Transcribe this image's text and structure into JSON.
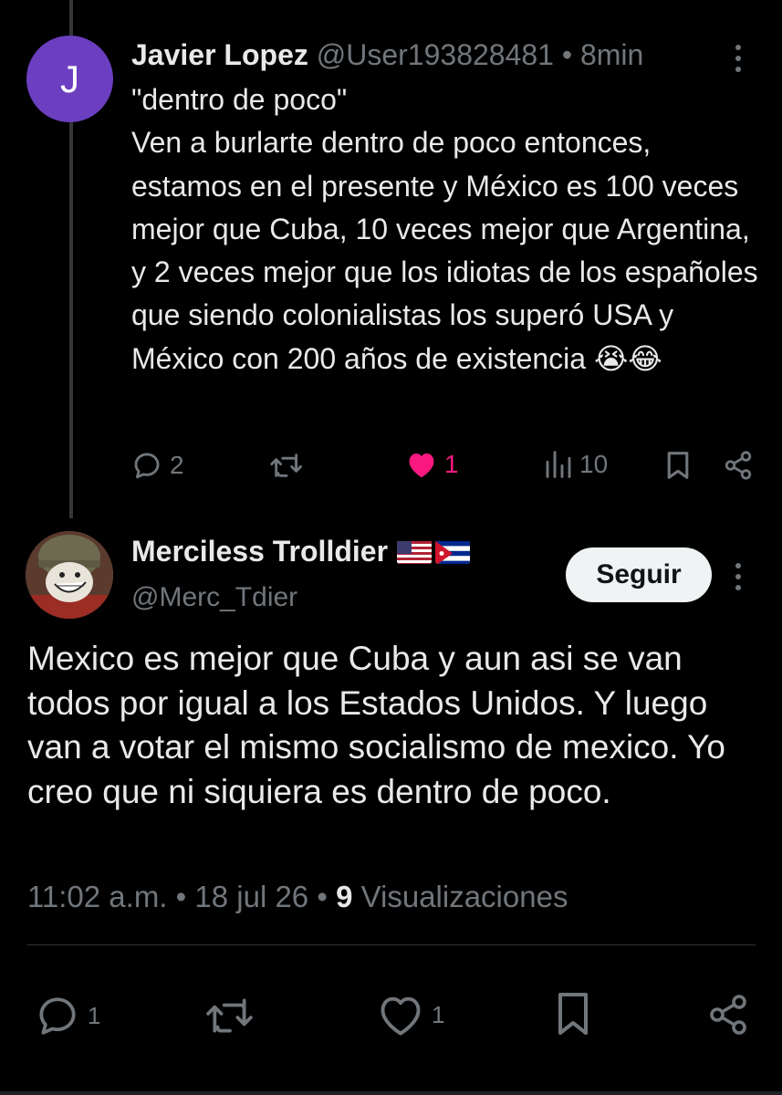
{
  "tweet1": {
    "avatar_letter": "J",
    "name": "Javier Lopez",
    "handle": "@User193828481",
    "separator": "•",
    "time": "8min",
    "text": "\"dentro de poco\"\nVen a burlarte dentro de poco entonces, estamos en el presente y México es 100 veces mejor que Cuba, 10 veces mejor que Argentina, y 2 veces mejor que los idiotas de los españoles que siendo colonialistas los superó USA y México con 200 años de existencia 😭😂",
    "replies": "2",
    "likes": "1",
    "views": "10",
    "liked": true,
    "like_color": "#f91880"
  },
  "tweet2": {
    "name": "Merciless Trolldier",
    "flags": [
      "us-flag",
      "cuba-flag"
    ],
    "handle": "@Merc_Tdier",
    "follow_label": "Seguir",
    "text": "Mexico es mejor que Cuba y aun asi se van todos por igual a los Estados Unidos. Y luego van a votar el mismo socialismo de mexico. Yo creo que ni siquiera es dentro de poco.",
    "time": "11:02 a.m.",
    "date": "18 jul 26",
    "views_count": "9",
    "views_label": "Visualizaciones",
    "replies": "1",
    "likes": "1"
  },
  "icons": [
    "reply-icon",
    "retweet-icon",
    "like-icon",
    "views-icon",
    "bookmark-icon",
    "share-icon",
    "more-icon"
  ],
  "colors": {
    "background": "#000000",
    "text": "#e7e9ea",
    "muted": "#71767b",
    "like": "#f91880",
    "avatar_j": "#6c3fc0"
  }
}
